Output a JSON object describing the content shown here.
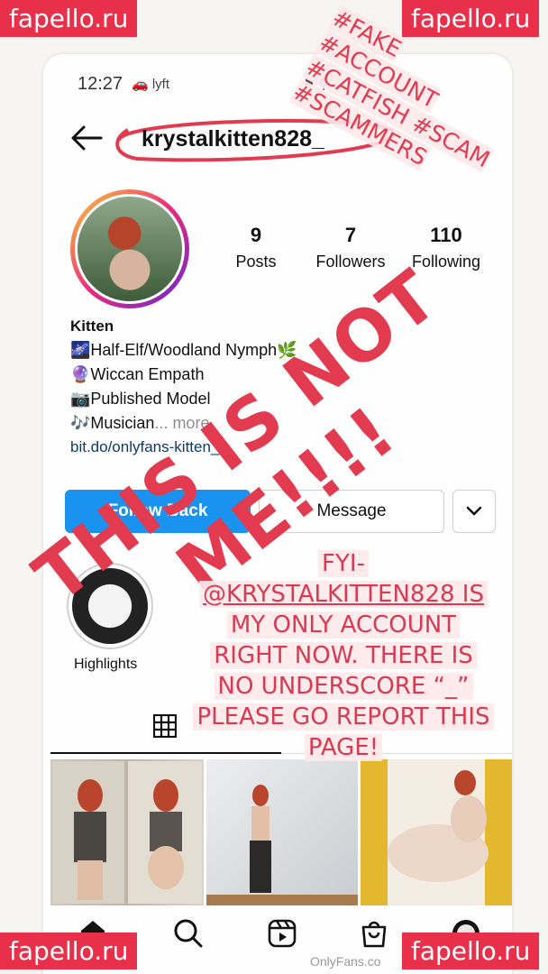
{
  "status_bar": {
    "time": "12:27",
    "left_icons": "🚗 lyft",
    "right_icons": "⚑ ⚲"
  },
  "profile": {
    "handle": "krystalkitten828_",
    "stats": [
      {
        "num": "9",
        "label": "Posts"
      },
      {
        "num": "7",
        "label": "Followers"
      },
      {
        "num": "110",
        "label": "Following"
      }
    ],
    "name": "Kitten",
    "bio": [
      "🌌Half-Elf/Woodland Nymph🌿",
      "🔮Wiccan Empath",
      "📷Published Model",
      "🎶Musician"
    ],
    "bio_more": "... more",
    "link": "bit.do/onlyfans-kitten_"
  },
  "buttons": {
    "follow": "Follow Back",
    "message": "Message",
    "more_icon": "chevron-down"
  },
  "highlights": {
    "label": "Highlights"
  },
  "overlay": {
    "not_me": "THIS IS NOT ME!!!!",
    "hashtags": [
      "#FAKE #ACCOUNT",
      "#CATFISH #SCAM",
      "#SCAMMERS"
    ],
    "fyi_lines": [
      "FYI-",
      "@KRYSTALKITTEN828 IS",
      "MY ONLY ACCOUNT",
      "RIGHT NOW. THERE IS",
      "NO UNDERSCORE “_”",
      "PLEASE GO REPORT THIS",
      "PAGE!"
    ]
  },
  "watermarks": {
    "brand": "fapello.ru",
    "onlyfans": "OnlyFans.co"
  },
  "colors": {
    "accent_red": "#e23b4f",
    "follow_blue": "#1a92ef"
  }
}
